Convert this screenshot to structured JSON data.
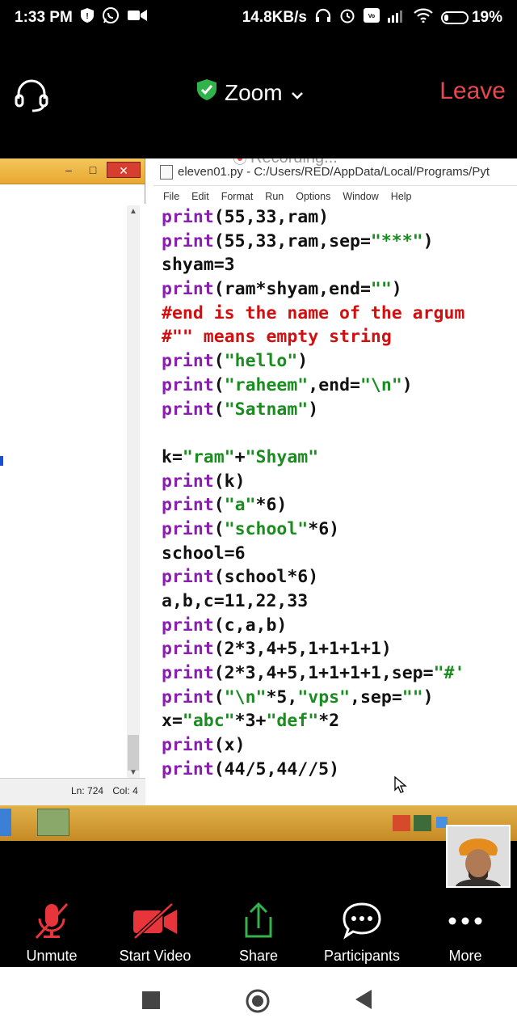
{
  "status_bar": {
    "time": "1:33 PM",
    "net_speed": "14.8KB/s",
    "battery_percent": "19%",
    "battery_level": 0.19
  },
  "zoom_header": {
    "title": "Zoom",
    "leave_label": "Leave",
    "accent_green": "#2fb34a",
    "leave_color": "#e8474f"
  },
  "shared_screen": {
    "recording_label": "Recording...",
    "left_window": {
      "status_ln": "Ln: 724",
      "status_col": "Col: 4"
    },
    "idle_window": {
      "title": "eleven01.py - C:/Users/RED/AppData/Local/Programs/Pyt",
      "menu": [
        "File",
        "Edit",
        "Format",
        "Run",
        "Options",
        "Window",
        "Help"
      ],
      "code_lines": [
        [
          [
            "kw",
            "print"
          ],
          [
            "def",
            "(55,33,ram)"
          ]
        ],
        [
          [
            "kw",
            "print"
          ],
          [
            "def",
            "(55,33,ram,sep="
          ],
          [
            "str",
            "\"***\""
          ],
          [
            "def",
            ")"
          ]
        ],
        [
          [
            "def",
            "shyam=3"
          ]
        ],
        [
          [
            "kw",
            "print"
          ],
          [
            "def",
            "(ram*shyam,end="
          ],
          [
            "str",
            "\"\""
          ],
          [
            "def",
            ")"
          ]
        ],
        [
          [
            "cmt",
            "#end is the name of the argum"
          ]
        ],
        [
          [
            "cmt",
            "#\"\" means empty string"
          ]
        ],
        [
          [
            "kw",
            "print"
          ],
          [
            "def",
            "("
          ],
          [
            "str",
            "\"hello\""
          ],
          [
            "def",
            ")"
          ]
        ],
        [
          [
            "kw",
            "print"
          ],
          [
            "def",
            "("
          ],
          [
            "str",
            "\"raheem\""
          ],
          [
            "def",
            ",end="
          ],
          [
            "str",
            "\"\\n\""
          ],
          [
            "def",
            ")"
          ]
        ],
        [
          [
            "kw",
            "print"
          ],
          [
            "def",
            "("
          ],
          [
            "str",
            "\"Satnam\""
          ],
          [
            "def",
            ")"
          ]
        ],
        [
          [
            "def",
            ""
          ]
        ],
        [
          [
            "def",
            "k="
          ],
          [
            "str",
            "\"ram\""
          ],
          [
            "def",
            "+"
          ],
          [
            "str",
            "\"Shyam\""
          ]
        ],
        [
          [
            "kw",
            "print"
          ],
          [
            "def",
            "(k)"
          ]
        ],
        [
          [
            "kw",
            "print"
          ],
          [
            "def",
            "("
          ],
          [
            "str",
            "\"a\""
          ],
          [
            "def",
            "*6)"
          ]
        ],
        [
          [
            "kw",
            "print"
          ],
          [
            "def",
            "("
          ],
          [
            "str",
            "\"school\""
          ],
          [
            "def",
            "*6)"
          ]
        ],
        [
          [
            "def",
            "school=6"
          ]
        ],
        [
          [
            "kw",
            "print"
          ],
          [
            "def",
            "(school*6)"
          ]
        ],
        [
          [
            "def",
            "a,b,c=11,22,33"
          ]
        ],
        [
          [
            "kw",
            "print"
          ],
          [
            "def",
            "(c,a,b)"
          ]
        ],
        [
          [
            "kw",
            "print"
          ],
          [
            "def",
            "(2*3,4+5,1+1+1+1)"
          ]
        ],
        [
          [
            "kw",
            "print"
          ],
          [
            "def",
            "(2*3,4+5,1+1+1+1,sep="
          ],
          [
            "str",
            "\"#'"
          ]
        ],
        [
          [
            "kw",
            "print"
          ],
          [
            "def",
            "("
          ],
          [
            "str",
            "\"\\n\""
          ],
          [
            "def",
            "*5,"
          ],
          [
            "str",
            "\"vps\""
          ],
          [
            "def",
            ",sep="
          ],
          [
            "str",
            "\"\""
          ],
          [
            "def",
            ")"
          ]
        ],
        [
          [
            "def",
            "x="
          ],
          [
            "str",
            "\"abc\""
          ],
          [
            "def",
            "*3+"
          ],
          [
            "str",
            "\"def\""
          ],
          [
            "def",
            "*2"
          ]
        ],
        [
          [
            "kw",
            "print"
          ],
          [
            "def",
            "(x)"
          ]
        ],
        [
          [
            "kw",
            "print"
          ],
          [
            "def",
            "(44/5,44//5)"
          ]
        ]
      ]
    }
  },
  "toolbar": {
    "unmute_label": "Unmute",
    "start_video_label": "Start Video",
    "share_label": "Share",
    "participants_label": "Participants",
    "more_label": "More"
  },
  "icons": {
    "audio": "headphones-icon",
    "shield": "shield-check-icon",
    "chevron": "chevron-down-icon",
    "mic_muted": "mic-muted-icon",
    "video_off": "video-off-icon",
    "share": "share-arrow-icon",
    "participants": "chat-bubble-icon",
    "more": "more-dots-icon"
  }
}
